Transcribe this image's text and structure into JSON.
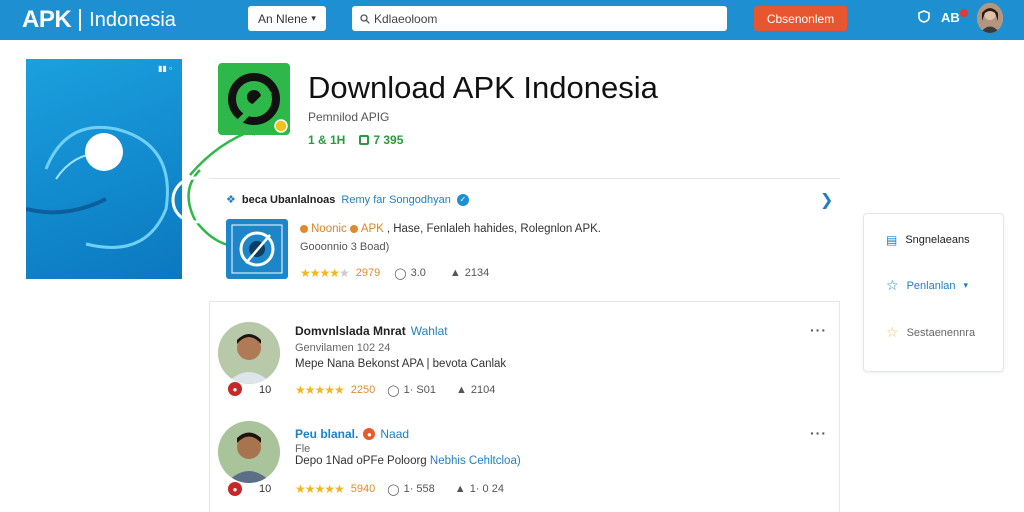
{
  "header": {
    "brand": "APK",
    "brand_sub": "Indonesia",
    "language_label": "An Nlene",
    "search_placeholder": "Kdlaeoloom",
    "cta_label": "Cbsenonlem",
    "points_label": "AB",
    "colors": {
      "bar": "#1e8fd0",
      "cta": "#e8562f"
    }
  },
  "app": {
    "title": "Download APK Indonesia",
    "subtitle": "Pemnilod APIG",
    "stat_downloads": "1 & 1H",
    "stat_size": "7 395"
  },
  "featured": {
    "heading_bold": "beca Ubanlalnoas",
    "heading_blue": "Remy far Songodhyan",
    "line1_a": "Noonic",
    "line1_b": "APK",
    "line1_c": ", Hase, Fenlaleh hahides, Rolegnlon APK.",
    "line2": "Gooonnio 3 Boad)",
    "rating_value": "2979",
    "comments": "3.0",
    "likes": "2134",
    "stars": 4
  },
  "reviews": [
    {
      "name": "Domvnlslada Mnrat",
      "tag": "Wahlat",
      "date": "Genvilamen 102 24",
      "text": "Mepe Nana Bekonst APA | bevota Canlak",
      "badge_count": "10",
      "rating_value": "2250",
      "comments": "1· S01",
      "likes": "2104",
      "stars": 5
    },
    {
      "name": "Peu blanal.",
      "tag": "Naad",
      "date": "Fle",
      "text_a": "Depo 1Nad oPFe Poloorg",
      "text_b": "Nebhis Cehltcloa)",
      "badge_count": "10",
      "rating_value": "5940",
      "comments": "1· 558",
      "likes": "1· 0 24",
      "stars": 5
    }
  ],
  "sidebar": {
    "items": [
      {
        "label": "Sngnelaeans",
        "icon": "list-icon"
      },
      {
        "label": "Penlanlan",
        "icon": "star-outline-icon"
      },
      {
        "label": "Sestaenennra",
        "icon": "star-faded-icon"
      }
    ]
  }
}
